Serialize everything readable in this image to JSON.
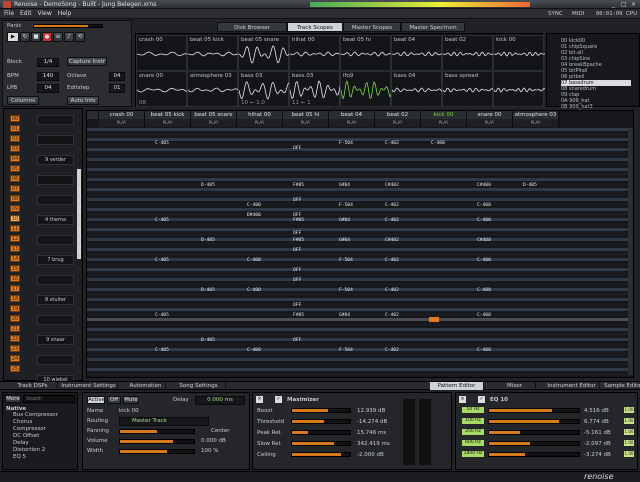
{
  "window": {
    "title": "Renoise - DemoSong - Built - Jung Belegen.xrns"
  },
  "menu": [
    "File",
    "Edit",
    "View",
    "Help"
  ],
  "header": {
    "panic_label": "Panic",
    "sync_label": "SYNC",
    "midi_label": "MIDI",
    "time": "00:01:09",
    "cpu_label": "CPU"
  },
  "top_tabs": [
    "Disk Browser",
    "Track Scopes",
    "Master Scopes",
    "Master Spectrum"
  ],
  "top_tabs_active": 1,
  "controls": {
    "block_label": "Block",
    "block_value": "1/4",
    "capture_label": "Capture Instr",
    "bpm_label": "BPM",
    "bpm_value": "140",
    "octave_label": "Octave",
    "octave_value": "04",
    "lpb_label": "LPB",
    "lpb_value": "04",
    "editstep_label": "Editstep",
    "editstep_value": "01",
    "columns_label": "Columns",
    "autoinfo_label": "Auto Info"
  },
  "scopes": {
    "row1": [
      "crash 00",
      "beat 05 kick",
      "beat 05 snare",
      "hihat 00",
      "beat 05 hi",
      "beat 04",
      "beat 02",
      "kick 00"
    ],
    "row2": [
      "snare 00",
      "atmosphere 03",
      "bass 03",
      "bass 03",
      "lfo9",
      "bass 04",
      "bass spread",
      ""
    ],
    "row1_numbers": [
      "",
      "",
      "",
      "",
      "",
      "",
      "",
      ""
    ],
    "row2_numbers": [
      "08",
      "",
      "10 ← 1.0",
      "11 ← 1",
      "",
      "",
      "",
      ""
    ]
  },
  "instruments": [
    "00 kick00",
    "01 chipSquare",
    "02 bit.all",
    "03 chipSine",
    "04 breakBpache",
    "05 bitPitall",
    "06 pitbell",
    "07 bassdrum",
    "08 snaredrum",
    "09 clap",
    "0A 909_hat",
    "0B 909_hat3"
  ],
  "instruments_selected": 7,
  "sequence": {
    "numbers": [
      "00",
      "01",
      "02",
      "03",
      "04",
      "05",
      "06",
      "07",
      "08",
      "09",
      "10",
      "11",
      "12",
      "13",
      "14",
      "15",
      "16",
      "17",
      "18",
      "19",
      "20",
      "21",
      "22",
      "23",
      "24",
      "25",
      "26"
    ],
    "selected": 10,
    "names": [
      "",
      "",
      "9 verder",
      "",
      "",
      "4 thema",
      "",
      "7 brug",
      "",
      "8 stuiter",
      "",
      "9 snaar",
      "",
      "10 wiebel"
    ]
  },
  "tracks": [
    "crash 00",
    "beat 05 kick",
    "beat 05 snare",
    "hihat 00",
    "beat 05 hi",
    "beat 04",
    "beat 02",
    "kick 00",
    "snare 00",
    "atmosphere 03"
  ],
  "track_ctl": "PLAY",
  "pattern_notes": [
    {
      "r": 5,
      "t": 1,
      "v": "C-405"
    },
    {
      "r": 5,
      "t": 5,
      "v": "F-504"
    },
    {
      "r": 5,
      "t": 6,
      "v": "C-402"
    },
    {
      "r": 5,
      "t": 7,
      "v": "C-400"
    },
    {
      "r": 7,
      "t": 4,
      "v": "OFF"
    },
    {
      "r": 22,
      "t": 2,
      "v": "D-405"
    },
    {
      "r": 22,
      "t": 4,
      "v": "F#05"
    },
    {
      "r": 22,
      "t": 5,
      "v": "G#04"
    },
    {
      "r": 22,
      "t": 6,
      "v": "C#402"
    },
    {
      "r": 22,
      "t": 8,
      "v": "C#400"
    },
    {
      "r": 22,
      "t": 9,
      "v": "D-405"
    },
    {
      "r": 28,
      "t": 4,
      "v": "OFF"
    },
    {
      "r": 30,
      "t": 3,
      "v": "C-400"
    },
    {
      "r": 30,
      "t": 5,
      "v": "F-504"
    },
    {
      "r": 30,
      "t": 6,
      "v": "C-402"
    },
    {
      "r": 30,
      "t": 8,
      "v": "C-400"
    },
    {
      "r": 34,
      "t": 3,
      "v": "D#400"
    },
    {
      "r": 34,
      "t": 4,
      "v": "OFF"
    },
    {
      "r": 36,
      "t": 1,
      "v": "C-405"
    },
    {
      "r": 36,
      "t": 4,
      "v": "F#05"
    },
    {
      "r": 36,
      "t": 5,
      "v": "G#04"
    },
    {
      "r": 36,
      "t": 6,
      "v": "C-402"
    },
    {
      "r": 36,
      "t": 8,
      "v": "C-400"
    },
    {
      "r": 41,
      "t": 4,
      "v": "OFF"
    },
    {
      "r": 44,
      "t": 2,
      "v": "D-405"
    },
    {
      "r": 44,
      "t": 4,
      "v": "F#05"
    },
    {
      "r": 44,
      "t": 5,
      "v": "G#04"
    },
    {
      "r": 44,
      "t": 6,
      "v": "C#402"
    },
    {
      "r": 44,
      "t": 8,
      "v": "C#400"
    },
    {
      "r": 48,
      "t": 4,
      "v": "OFF"
    },
    {
      "r": 52,
      "t": 1,
      "v": "C-405"
    },
    {
      "r": 52,
      "t": 3,
      "v": "C-400"
    },
    {
      "r": 52,
      "t": 5,
      "v": "F-504"
    },
    {
      "r": 52,
      "t": 6,
      "v": "C-402"
    },
    {
      "r": 52,
      "t": 8,
      "v": "C-400"
    },
    {
      "r": 56,
      "t": 4,
      "v": "OFF"
    },
    {
      "r": 60,
      "t": 4,
      "v": "OFF"
    },
    {
      "r": 64,
      "t": 2,
      "v": "D-405"
    },
    {
      "r": 64,
      "t": 3,
      "v": "C-400"
    },
    {
      "r": 64,
      "t": 5,
      "v": "F-504"
    },
    {
      "r": 64,
      "t": 6,
      "v": "C-402"
    },
    {
      "r": 64,
      "t": 8,
      "v": "C-400"
    },
    {
      "r": 70,
      "t": 4,
      "v": "OFF"
    },
    {
      "r": 74,
      "t": 1,
      "v": "C-405"
    },
    {
      "r": 74,
      "t": 4,
      "v": "F#05"
    },
    {
      "r": 74,
      "t": 5,
      "v": "G#04"
    },
    {
      "r": 74,
      "t": 6,
      "v": "C-402"
    },
    {
      "r": 74,
      "t": 8,
      "v": "C-400"
    },
    {
      "r": 84,
      "t": 2,
      "v": "D-405"
    },
    {
      "r": 84,
      "t": 4,
      "v": "OFF"
    },
    {
      "r": 88,
      "t": 1,
      "v": "C-405"
    },
    {
      "r": 88,
      "t": 3,
      "v": "C-400"
    },
    {
      "r": 88,
      "t": 5,
      "v": "F-504"
    },
    {
      "r": 88,
      "t": 6,
      "v": "C-402"
    },
    {
      "r": 88,
      "t": 8,
      "v": "C-400"
    }
  ],
  "bottom_tabs": [
    "Track DSPs",
    "Instrument Settings",
    "Automation",
    "Song Settings",
    "Pattern Editor",
    "Mixer",
    "Instrument Editor",
    "Sample Editor"
  ],
  "bottom_tabs_active": 4,
  "dsp_list": {
    "header": "More",
    "search_placeholder": "Search",
    "category": "Native",
    "items": [
      "Bus Compressor",
      "Chorus",
      "Compressor",
      "DC Offset",
      "Delay",
      "Distortion 2",
      "EQ 5"
    ]
  },
  "track_settings": {
    "active_label": "Active",
    "off_label": "Off",
    "mute_label": "Mute",
    "delay_label": "Delay",
    "delay_value": "0.000 ms",
    "name_label": "Name",
    "name_value": "kick 00",
    "routing_label": "Routing",
    "routing_value": "Master Track",
    "panning_label": "Panning",
    "panning_value": "Center",
    "volume_label": "Volume",
    "volume_value": "0.000 dB",
    "width_label": "Width",
    "width_value": "100 %"
  },
  "maximizer": {
    "title": "Maximizer",
    "params": [
      {
        "name": "Boost",
        "value": "12.939 dB"
      },
      {
        "name": "Threshold",
        "value": "-14.274 dB"
      },
      {
        "name": "Peak Rel.",
        "value": "15.746 ms"
      },
      {
        "name": "Slow Rel.",
        "value": "342.419 ms"
      },
      {
        "name": "Ceiling",
        "value": "-2.000 dB"
      }
    ]
  },
  "eq": {
    "title": "EQ 10",
    "bands": [
      {
        "f": "50 Hz",
        "v": "4.516 dB"
      },
      {
        "f": "100 Hz",
        "v": "6.774 dB"
      },
      {
        "f": "200 Hz",
        "v": "-5.161 dB"
      },
      {
        "f": "600 Hz",
        "v": "-2.097 dB"
      },
      {
        "f": "1800 Hz",
        "v": "-3.274 dB"
      }
    ],
    "right_btns": [
      "1.00",
      "1.00",
      "1.00",
      "1.00",
      "1.00"
    ]
  },
  "brand": "renoise",
  "colors": {
    "accent": "#e07b22",
    "highlight": "#a8d866",
    "bg": "#202226"
  }
}
